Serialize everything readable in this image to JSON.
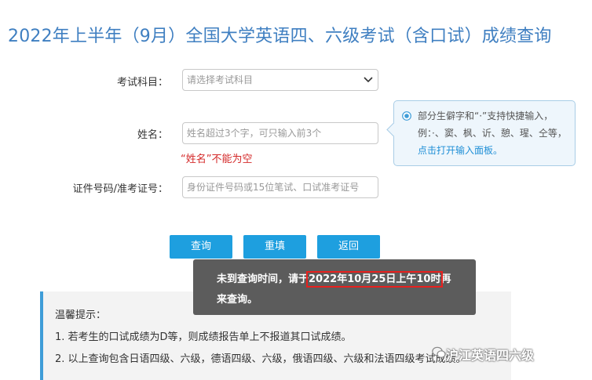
{
  "page": {
    "title": "2022年上半年（9月）全国大学英语四、六级考试（含口试）成绩查询"
  },
  "form": {
    "subject": {
      "label": "考试科目：",
      "value": "请选择考试科目"
    },
    "name": {
      "label": "姓名：",
      "placeholder": "姓名超过3个字，可只输入前3个",
      "error": "“姓名”不能为空"
    },
    "id_number": {
      "label": "证件号码/准考证号：",
      "placeholder": "身份证件号码或15位笔试、口试准考证号"
    }
  },
  "hint": {
    "text": "部分生僻字和“·”支持快捷输入，例：·、窦、枫、䜣、憩、瑆、仝等，",
    "link": "点击打开输入面板。"
  },
  "buttons": {
    "query": "查询",
    "reset": "重填",
    "back": "返回"
  },
  "toast": {
    "prefix": "未到查询时间，请于",
    "highlight": "2022年10月25日上午10时",
    "suffix": "再来查询。"
  },
  "tips": {
    "title": "温馨提示：",
    "items": [
      "1. 若考生的口试成绩为D等，则成绩报告单上不报道其口试成绩。",
      "2. 以上查询包含日语四级、六级，德语四级、六级，俄语四级、六级和法语四级考试成绩。"
    ]
  },
  "watermark": {
    "text": "沪江英语四六级"
  },
  "colors": {
    "accent": "#1e9fdf",
    "title": "#3f7fc1",
    "error": "#d42a2a",
    "highlight_border": "#e8201e"
  }
}
